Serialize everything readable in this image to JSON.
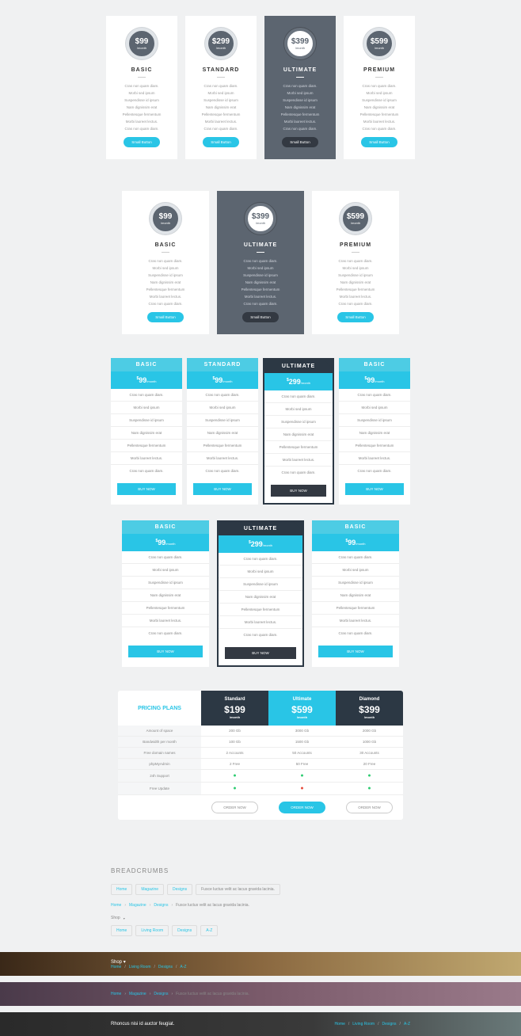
{
  "features_list": [
    "Cras non quam diam.",
    "Morbi sed ipsum",
    "Suspendisse id ipsum",
    "Nam dignissim erat",
    "Pellentesque fermentum",
    "Morbi laoreet lectus.",
    "Cras non quam diam."
  ],
  "btn_small": "Small Button",
  "btn_buy": "BUY NOW",
  "row1": [
    {
      "name": "BASIC",
      "price": "$99",
      "period": "/month",
      "featured": false
    },
    {
      "name": "STANDARD",
      "price": "$299",
      "period": "/month",
      "featured": false
    },
    {
      "name": "ULTIMATE",
      "price": "$399",
      "period": "/month",
      "featured": true
    },
    {
      "name": "PREMIUM",
      "price": "$599",
      "period": "/month",
      "featured": false
    }
  ],
  "row2": [
    {
      "name": "BASIC",
      "price": "$99",
      "period": "/month",
      "featured": false
    },
    {
      "name": "ULTIMATE",
      "price": "$399",
      "period": "/month",
      "featured": true
    },
    {
      "name": "PREMIUM",
      "price": "$599",
      "period": "/month",
      "featured": false
    }
  ],
  "row3": [
    {
      "name": "BASIC",
      "price": "99",
      "featured": false
    },
    {
      "name": "STANDARD",
      "price": "99",
      "featured": false
    },
    {
      "name": "ULTIMATE",
      "price": "299",
      "featured": true
    },
    {
      "name": "BASIC",
      "price": "99",
      "featured": false
    }
  ],
  "row4": [
    {
      "name": "BASIC",
      "price": "99",
      "featured": false
    },
    {
      "name": "ULTIMATE",
      "price": "299",
      "featured": true
    },
    {
      "name": "BASIC",
      "price": "99",
      "featured": false
    }
  ],
  "month_sm": "/month",
  "table": {
    "title": "PRICING PLANS",
    "plans": [
      {
        "name": "Standard",
        "price": "$199",
        "hl": false,
        "btn": "ORDER NOW"
      },
      {
        "name": "Ultimate",
        "price": "$599",
        "hl": true,
        "btn": "ORDER NOW"
      },
      {
        "name": "Diamond",
        "price": "$399",
        "hl": false,
        "btn": "ORDER NOW"
      }
    ],
    "rows": [
      {
        "label": "Amount of space",
        "vals": [
          "200 Gb",
          "3000 Gb",
          "2000 Gb"
        ]
      },
      {
        "label": "Bandwidth per month",
        "vals": [
          "100 Gb",
          "1500 Gb",
          "1000 Gb"
        ]
      },
      {
        "label": "Free domain names",
        "vals": [
          "2 Accounts",
          "50 Accounts",
          "30 Accounts"
        ]
      },
      {
        "label": "phpMyAdmin",
        "vals": [
          "2 Free",
          "50 Free",
          "20 Free"
        ]
      },
      {
        "label": "24h Support",
        "vals": [
          "g",
          "g",
          "g"
        ]
      },
      {
        "label": "Free Update",
        "vals": [
          "g",
          "r",
          "g"
        ]
      }
    ]
  },
  "bc_title": "BREADCRUMBS",
  "bc1": {
    "items": [
      "Home",
      "Magazine",
      "Designs"
    ],
    "last": "Fusce luctus velit ac lacus gravida lacinia."
  },
  "bc2": {
    "items": [
      "Home",
      "Magazine",
      "Designs"
    ],
    "last": "Fusce luctus velit ac lacus gravida lacinia."
  },
  "bc3": {
    "label": "Shop",
    "items": [
      "Home",
      "Living Room",
      "Designs",
      "A-Z"
    ]
  },
  "hero1": {
    "label": "Shop",
    "items": [
      "Home",
      "Living Room",
      "Designs",
      "A-Z"
    ]
  },
  "hero2": {
    "items": [
      "Home",
      "Magazine",
      "Designs"
    ],
    "last": "Fusce luctus velit ac lacus gravida lacinia."
  },
  "hero3": {
    "left": "Rhoncus nisi id auctor feugiat.",
    "items": [
      "Home",
      "Living Room",
      "Designs",
      "A-Z"
    ]
  }
}
